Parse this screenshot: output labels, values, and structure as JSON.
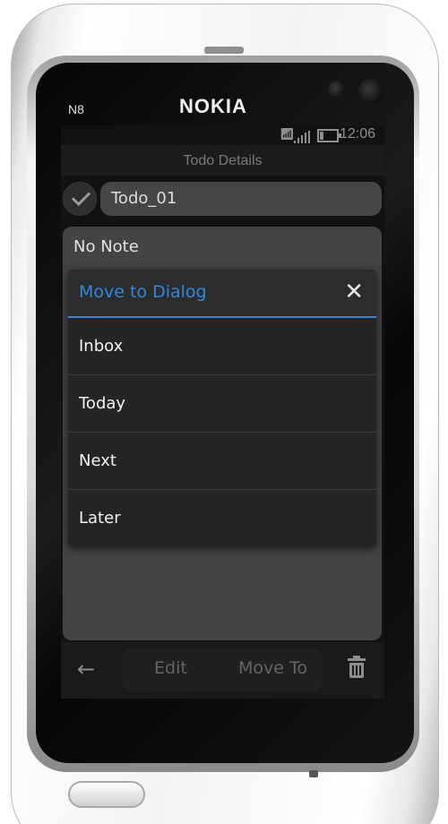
{
  "device": {
    "model": "N8",
    "brand": "NOKIA"
  },
  "status_bar": {
    "time": "12:06",
    "icons": [
      "signal-icon",
      "signal-bars-icon",
      "battery-icon"
    ]
  },
  "screen": {
    "title": "Todo Details"
  },
  "todo": {
    "name": "Todo_01",
    "note": "No Note",
    "completed_icon": "check-icon"
  },
  "dialog": {
    "title": "Move to Dialog",
    "close_icon": "close-icon",
    "options": [
      "Inbox",
      "Today",
      "Next",
      "Later"
    ]
  },
  "toolbar": {
    "back_icon": "back-arrow-icon",
    "edit_label": "Edit",
    "move_label": "Move To",
    "delete_icon": "trash-icon"
  },
  "colors": {
    "accent": "#2f88de",
    "dialog_bg": "#252525",
    "panel_bg": "#444444"
  }
}
